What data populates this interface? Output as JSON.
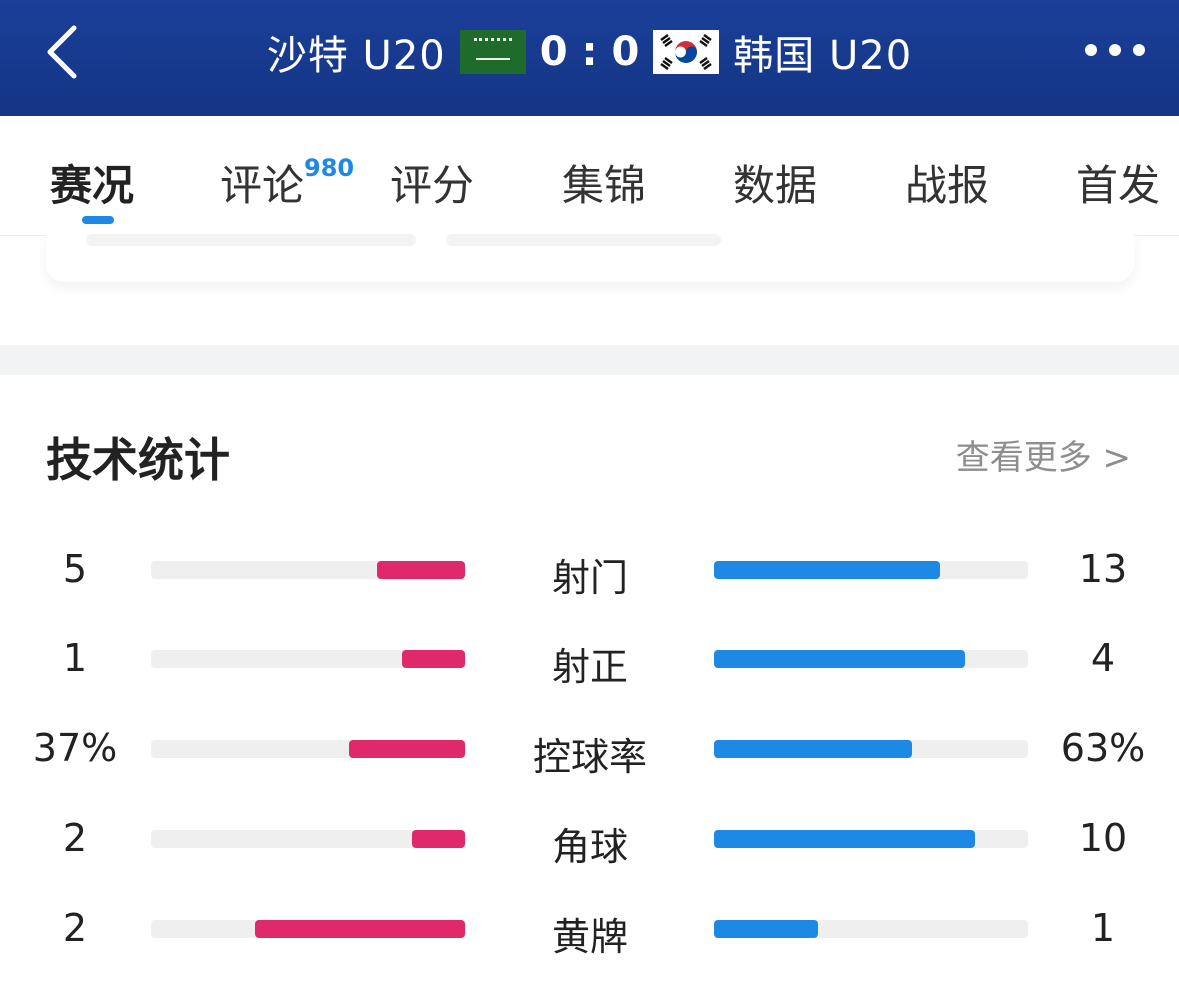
{
  "header": {
    "home_team": "沙特 U20",
    "away_team": "韩国 U20",
    "home_score": "0",
    "score_separator": ":",
    "away_score": "0",
    "back_icon": "chevron-left-icon",
    "more_icon": "more-dots-icon",
    "home_flag_icon": "saudi-arabia-flag-icon",
    "away_flag_icon": "south-korea-flag-icon",
    "bg_color": "#1b3f9a"
  },
  "tabs": [
    {
      "label": "赛况",
      "active": true
    },
    {
      "label": "评论",
      "badge": "980"
    },
    {
      "label": "评分"
    },
    {
      "label": "集锦"
    },
    {
      "label": "数据"
    },
    {
      "label": "战报"
    },
    {
      "label": "首发"
    }
  ],
  "stats": {
    "title": "技术统计",
    "see_more": "查看更多 >",
    "colors": {
      "home": "#e0296b",
      "away": "#1e88e5"
    },
    "rows": [
      {
        "label": "射门",
        "home": "5",
        "away": "13",
        "home_fill": 0.28,
        "away_fill": 0.72
      },
      {
        "label": "射正",
        "home": "1",
        "away": "4",
        "home_fill": 0.2,
        "away_fill": 0.8
      },
      {
        "label": "控球率",
        "home": "37%",
        "away": "63%",
        "home_fill": 0.37,
        "away_fill": 0.63
      },
      {
        "label": "角球",
        "home": "2",
        "away": "10",
        "home_fill": 0.17,
        "away_fill": 0.83
      },
      {
        "label": "黄牌",
        "home": "2",
        "away": "1",
        "home_fill": 0.67,
        "away_fill": 0.33
      }
    ]
  }
}
